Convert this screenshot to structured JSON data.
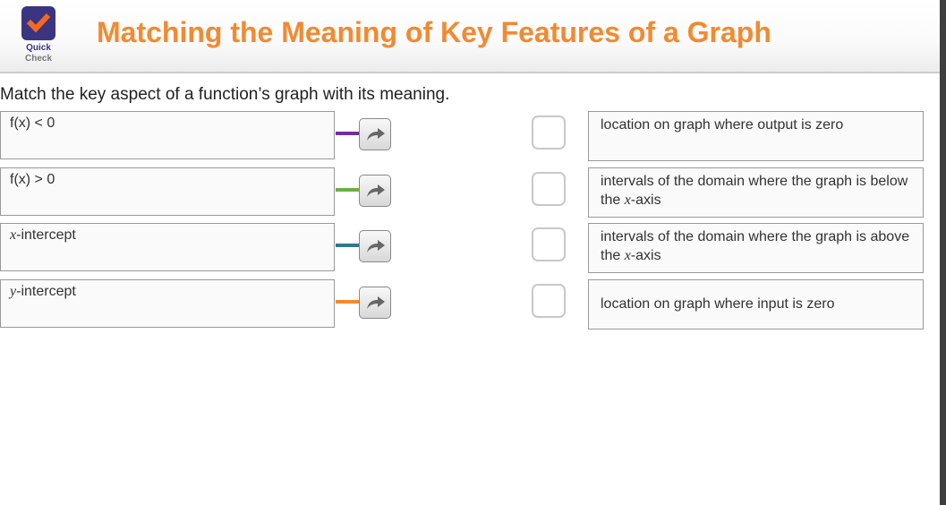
{
  "header": {
    "title": "Matching the Meaning of Key Features of a Graph",
    "logo_line1": "Quick",
    "logo_line2": "Check",
    "accent": "#f28a30",
    "logo_color": "#3b3480"
  },
  "prompt": "Match the key aspect of a function’s graph with its meaning.",
  "left_items": [
    {
      "label": "f(x) < 0",
      "color": "#7030a0"
    },
    {
      "label": "f(x) > 0",
      "color": "#70ad47"
    },
    {
      "label": "x-intercept",
      "color": "#31788a"
    },
    {
      "label": "y-intercept",
      "color": "#f28a30"
    }
  ],
  "right_items": [
    {
      "label": "location on graph where output is zero"
    },
    {
      "label": "intervals of the domain where the graph is below the x-axis"
    },
    {
      "label": "intervals of the domain where the graph is above the x-axis"
    },
    {
      "label": "location on graph where input is zero"
    }
  ]
}
